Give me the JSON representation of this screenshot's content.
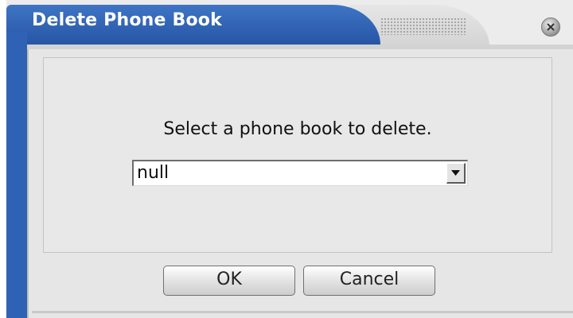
{
  "window": {
    "title": "Delete Phone Book"
  },
  "dialog": {
    "prompt": "Select a phone book to delete.",
    "select": {
      "value": "null"
    },
    "ok_label": "OK",
    "cancel_label": "Cancel"
  },
  "icons": {
    "close": "close-icon",
    "dropdown": "chevron-down-icon"
  },
  "colors": {
    "title_bar": "#2f62b5",
    "panel_bg": "#e8e8e8",
    "title_text": "#ffffff"
  }
}
